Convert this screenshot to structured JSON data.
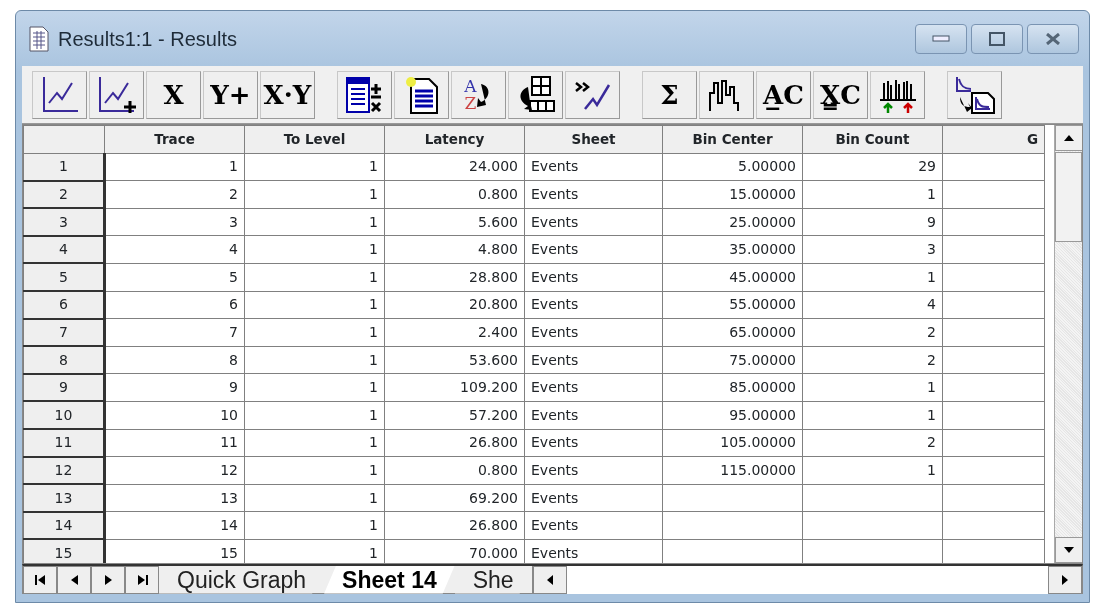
{
  "window": {
    "title": "Results1:1 - Results"
  },
  "toolbar": [
    [
      {
        "kind": "line-graph"
      },
      {
        "kind": "add-graph"
      },
      {
        "kind": "glyph",
        "label": "X"
      },
      {
        "kind": "glyph",
        "label": "Y+"
      },
      {
        "kind": "glyph",
        "label": "X·Y"
      }
    ],
    [
      {
        "kind": "table-calc"
      },
      {
        "kind": "new-sheet"
      },
      {
        "kind": "sort",
        "top": "A",
        "bottom": "Z"
      },
      {
        "kind": "rearrange"
      },
      {
        "kind": "join"
      }
    ],
    [
      {
        "kind": "glyph",
        "label": "Σ"
      },
      {
        "kind": "histogram"
      },
      {
        "kind": "glyph",
        "label": "A̲C"
      },
      {
        "kind": "glyph",
        "label": "X̳C"
      },
      {
        "kind": "events"
      }
    ],
    [
      {
        "kind": "copy-graph"
      }
    ]
  ],
  "table": {
    "columns": [
      "Trace",
      "To Level",
      "Latency",
      "Sheet",
      "Bin Center",
      "Bin Count",
      "G"
    ],
    "rows": [
      {
        "label": "1",
        "cells": [
          "1",
          "1",
          "24.000",
          "Events",
          "5.00000",
          "29"
        ]
      },
      {
        "label": "2",
        "cells": [
          "2",
          "1",
          "0.800",
          "Events",
          "15.00000",
          "1"
        ]
      },
      {
        "label": "3",
        "cells": [
          "3",
          "1",
          "5.600",
          "Events",
          "25.00000",
          "9"
        ]
      },
      {
        "label": "4",
        "cells": [
          "4",
          "1",
          "4.800",
          "Events",
          "35.00000",
          "3"
        ]
      },
      {
        "label": "5",
        "cells": [
          "5",
          "1",
          "28.800",
          "Events",
          "45.00000",
          "1"
        ]
      },
      {
        "label": "6",
        "cells": [
          "6",
          "1",
          "20.800",
          "Events",
          "55.00000",
          "4"
        ]
      },
      {
        "label": "7",
        "cells": [
          "7",
          "1",
          "2.400",
          "Events",
          "65.00000",
          "2"
        ]
      },
      {
        "label": "8",
        "cells": [
          "8",
          "1",
          "53.600",
          "Events",
          "75.00000",
          "2"
        ]
      },
      {
        "label": "9",
        "cells": [
          "9",
          "1",
          "109.200",
          "Events",
          "85.00000",
          "1"
        ]
      },
      {
        "label": "10",
        "cells": [
          "10",
          "1",
          "57.200",
          "Events",
          "95.00000",
          "1"
        ]
      },
      {
        "label": "11",
        "cells": [
          "11",
          "1",
          "26.800",
          "Events",
          "105.00000",
          "2"
        ]
      },
      {
        "label": "12",
        "cells": [
          "12",
          "1",
          "0.800",
          "Events",
          "115.00000",
          "1"
        ]
      },
      {
        "label": "13",
        "cells": [
          "13",
          "1",
          "69.200",
          "Events"
        ]
      },
      {
        "label": "14",
        "cells": [
          "14",
          "1",
          "26.800",
          "Events"
        ]
      },
      {
        "label": "15",
        "cells": [
          "15",
          "1",
          "70.000",
          "Events"
        ]
      }
    ]
  },
  "sheet_tabs": [
    {
      "label": "Quick Graph",
      "selected": false
    },
    {
      "label": "Sheet 14",
      "selected": true
    },
    {
      "label": "She",
      "selected": false
    }
  ]
}
